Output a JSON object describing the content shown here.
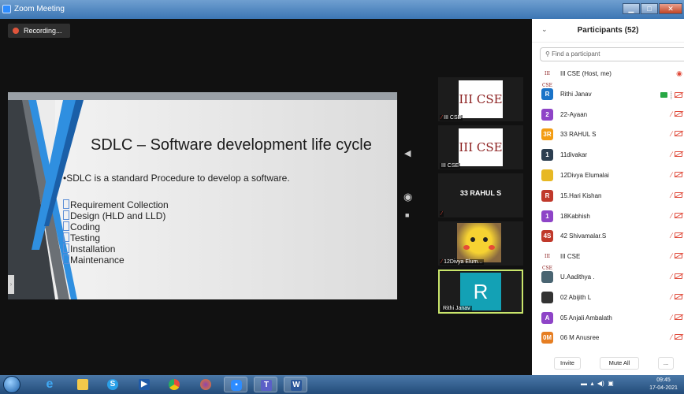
{
  "window": {
    "title": "Zoom Meeting"
  },
  "recording": {
    "label": "Recording..."
  },
  "slide": {
    "title": "SDLC – Software development life cycle",
    "intro": "•SDLC is a standard Procedure to develop a software.",
    "bullets": [
      "Requirement Collection",
      "Design (HLD and LLD)",
      "Coding",
      "Testing",
      "Installation",
      "Maintenance"
    ]
  },
  "videos": [
    {
      "card_text": "III CSE",
      "name": "III CSE"
    },
    {
      "card_text": "III CSE",
      "name": "III CSE"
    },
    {
      "display_name": "33 RAHUL S"
    },
    {
      "name": "12Divya Elum..."
    },
    {
      "initial": "R",
      "name": "Rithi Janav"
    }
  ],
  "participants": {
    "title": "Participants (52)",
    "search_placeholder": "Find a participant",
    "list": [
      {
        "avatar": "III CSE",
        "avatar_color": "",
        "name": "III CSE (Host, me)",
        "status": "recording"
      },
      {
        "avatar": "R",
        "avatar_color": "#1a73c8",
        "name": "Rithi Janav",
        "status": "sharing"
      },
      {
        "avatar": "2",
        "avatar_color": "#8e44c7",
        "name": "22-Ayaan",
        "status": "muted"
      },
      {
        "avatar": "3R",
        "avatar_color": "#f39c12",
        "name": "33 RAHUL S",
        "status": "muted"
      },
      {
        "avatar": "1",
        "avatar_color": "#2c3e50",
        "name": "11divakar",
        "status": "muted"
      },
      {
        "avatar": "",
        "avatar_color": "#e7b824",
        "name": "12Divya Elumalai",
        "status": "muted"
      },
      {
        "avatar": "R",
        "avatar_color": "#c0392b",
        "name": "15.Hari Kishan",
        "status": "muted"
      },
      {
        "avatar": "1",
        "avatar_color": "#8e44c7",
        "name": "18Kabhish",
        "status": "muted"
      },
      {
        "avatar": "4S",
        "avatar_color": "#c0392b",
        "name": "42 Shivamalar.S",
        "status": "muted"
      },
      {
        "avatar": "III CSE",
        "avatar_color": "",
        "name": "III CSE",
        "status": "muted"
      },
      {
        "avatar": "",
        "avatar_color": "#4a6572",
        "name": "U.Aadithya .",
        "status": "muted"
      },
      {
        "avatar": "",
        "avatar_color": "#333333",
        "name": "02 Abijith L",
        "status": "muted"
      },
      {
        "avatar": "A",
        "avatar_color": "#8e44c7",
        "name": "05 Anjali Ambalath",
        "status": "muted"
      },
      {
        "avatar": "0M",
        "avatar_color": "#e67e22",
        "name": "06 M Anusree",
        "status": "muted"
      }
    ],
    "invite_label": "Invite",
    "mute_all_label": "Mute All",
    "more_label": "..."
  },
  "taskbar": {
    "time": "09:45",
    "date": "17-04-2021"
  }
}
